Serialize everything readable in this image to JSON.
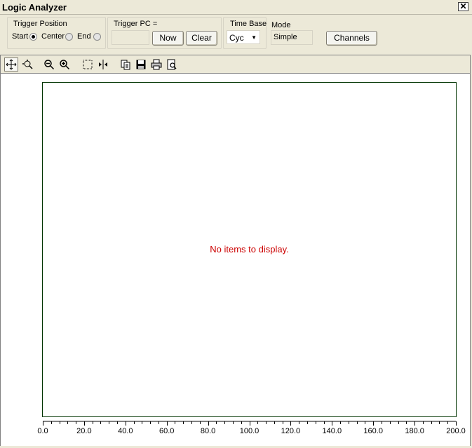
{
  "window": {
    "title": "Logic Analyzer",
    "close_glyph": "✕"
  },
  "trigger_position": {
    "label": "Trigger Position",
    "options": [
      {
        "label": "Start",
        "selected": true
      },
      {
        "label": "Center",
        "selected": false
      },
      {
        "label": "End",
        "selected": false
      }
    ]
  },
  "trigger_pc": {
    "label": "Trigger PC =",
    "value": "",
    "now_label": "Now",
    "clear_label": "Clear"
  },
  "time_base": {
    "label": "Time Base",
    "value": "Cyc"
  },
  "mode": {
    "label": "Mode",
    "value": "Simple"
  },
  "channels_label": "Channels",
  "toolbar": {
    "icons": [
      "move-icon",
      "zoom-region-icon",
      "zoom-out-icon",
      "zoom-in-icon",
      "select-rect-icon",
      "split-icon",
      "copy-icon",
      "save-icon",
      "print-icon",
      "print-preview-icon"
    ]
  },
  "plot": {
    "empty_message": "No items to display.",
    "frame_color": "#003300",
    "message_color": "#cc0000"
  },
  "chart_data": {
    "type": "line",
    "series": [],
    "xlim": [
      0,
      200
    ],
    "x_ticks": [
      "0.0",
      "20.0",
      "40.0",
      "60.0",
      "80.0",
      "100.0",
      "120.0",
      "140.0",
      "160.0",
      "180.0",
      "200.0"
    ],
    "minor_ticks_per_major": 4
  }
}
